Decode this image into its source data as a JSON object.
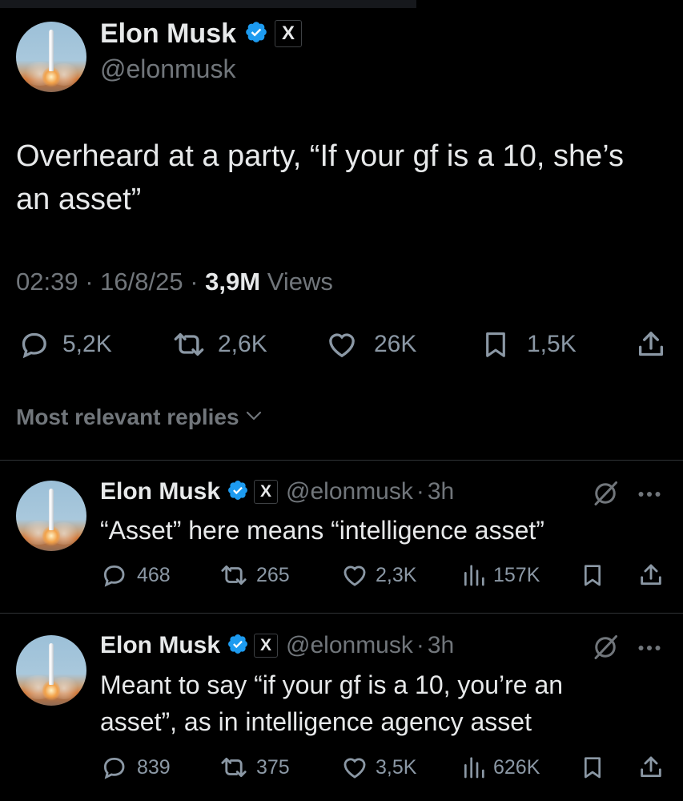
{
  "main_post": {
    "author_name": "Elon Musk",
    "author_handle": "@elonmusk",
    "affiliate_badge": "X",
    "text_line1": "Overheard at a party, “If your gf is a 10, she’s",
    "text_line2": "an asset”",
    "time": "02:39",
    "date": "16/8/25",
    "views_count": "3,9M",
    "views_label": "Views",
    "sep": "·",
    "replies": "5,2K",
    "reposts": "2,6K",
    "likes": "26K",
    "bookmarks": "1,5K"
  },
  "sort": {
    "label": "Most relevant replies"
  },
  "replies": [
    {
      "author_name": "Elon Musk",
      "affiliate_badge": "X",
      "handle": "@elonmusk",
      "age": "3h",
      "text_lines": [
        "“Asset” here means “intelligence asset”"
      ],
      "replies": "468",
      "reposts": "265",
      "likes": "2,3K",
      "views": "157K"
    },
    {
      "author_name": "Elon Musk",
      "affiliate_badge": "X",
      "handle": "@elonmusk",
      "age": "3h",
      "text_lines": [
        "Meant to say “if your gf is a 10, you’re an",
        "asset”, as in intelligence agency asset"
      ],
      "replies": "839",
      "reposts": "375",
      "likes": "3,5K",
      "views": "626K"
    }
  ],
  "colors": {
    "background": "#000000",
    "text": "#e7e9ea",
    "muted": "#71767b",
    "verified": "#1d9bf0",
    "divider": "#2f3336"
  },
  "icons": [
    "reply-icon",
    "repost-icon",
    "like-icon",
    "bookmark-icon",
    "share-icon",
    "views-icon",
    "grok-icon",
    "more-icon",
    "verified-icon"
  ]
}
